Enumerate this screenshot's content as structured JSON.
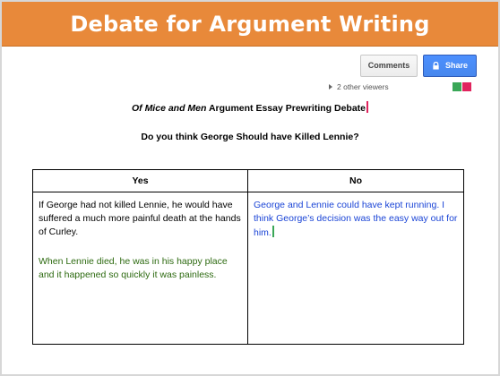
{
  "banner": {
    "title": "Debate for Argument Writing",
    "color": "#e8893a"
  },
  "toolbar": {
    "comments_label": "Comments",
    "share_label": "Share",
    "share_icon": "lock-icon",
    "viewers_text": "2 other viewers",
    "viewer_colors": [
      "#3aa757",
      "#e0245e"
    ]
  },
  "document": {
    "title_italic": "Of Mice and Men",
    "title_rest": " Argument Essay Prewriting Debate",
    "question": "Do you think George Should have Killed Lennie?",
    "table": {
      "headers": [
        "Yes",
        "No"
      ],
      "yes_arguments": [
        "If George had not killed Lennie, he would have suffered a much more painful death at the hands of Curley.",
        "When Lennie died, he was in his happy place and it happened so quickly it was painless."
      ],
      "no_arguments": [
        "George and Lennie could have kept running. I think George’s decision was the easy way out for him."
      ]
    },
    "text_colors": {
      "yes_first": "#000000",
      "yes_second": "#2d6a10",
      "no_first": "#1a44d6"
    }
  }
}
